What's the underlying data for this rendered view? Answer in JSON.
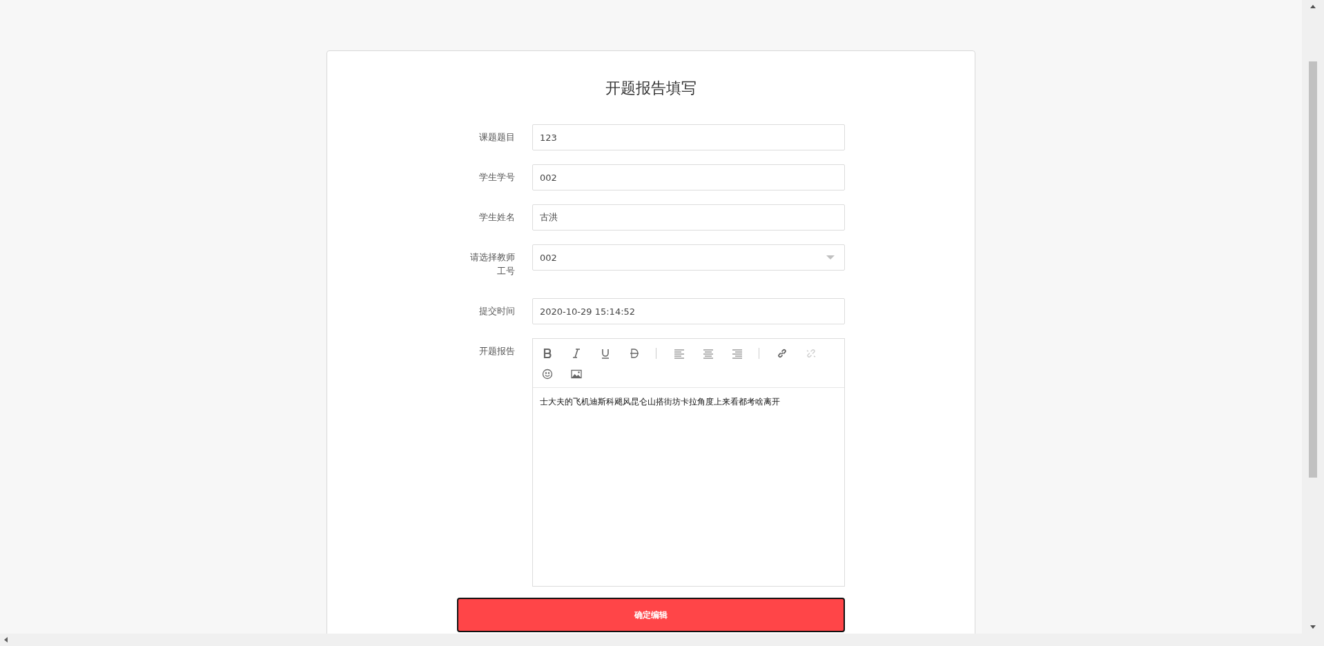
{
  "form": {
    "title": "开题报告填写",
    "fields": [
      {
        "kind": "text",
        "label": "课题题目",
        "value": "123"
      },
      {
        "kind": "text",
        "label": "学生学号",
        "value": "002"
      },
      {
        "kind": "text",
        "label": "学生姓名",
        "value": "古洪"
      },
      {
        "kind": "select",
        "label": "请选择教师工号",
        "value": "002"
      },
      {
        "kind": "text",
        "label": "提交时间",
        "value": "2020-10-29 15:14:52"
      }
    ],
    "editor": {
      "label": "开题报告",
      "toolbar": [
        {
          "kind": "bold",
          "disabled": false
        },
        {
          "kind": "italic",
          "disabled": false
        },
        {
          "kind": "underline",
          "disabled": false
        },
        {
          "kind": "strike",
          "disabled": false
        },
        {
          "kind": "sep"
        },
        {
          "kind": "align-left",
          "disabled": false
        },
        {
          "kind": "align-center",
          "disabled": false
        },
        {
          "kind": "align-right",
          "disabled": false
        },
        {
          "kind": "sep"
        },
        {
          "kind": "link",
          "disabled": false
        },
        {
          "kind": "unlink",
          "disabled": true
        },
        {
          "kind": "break"
        },
        {
          "kind": "emoji",
          "disabled": false
        },
        {
          "kind": "image",
          "disabled": false
        }
      ],
      "content": "士大夫的飞机迪斯科飓风昆仑山搭街坊卡拉角度上来看都考啥离开"
    },
    "submit": "确定编辑"
  }
}
